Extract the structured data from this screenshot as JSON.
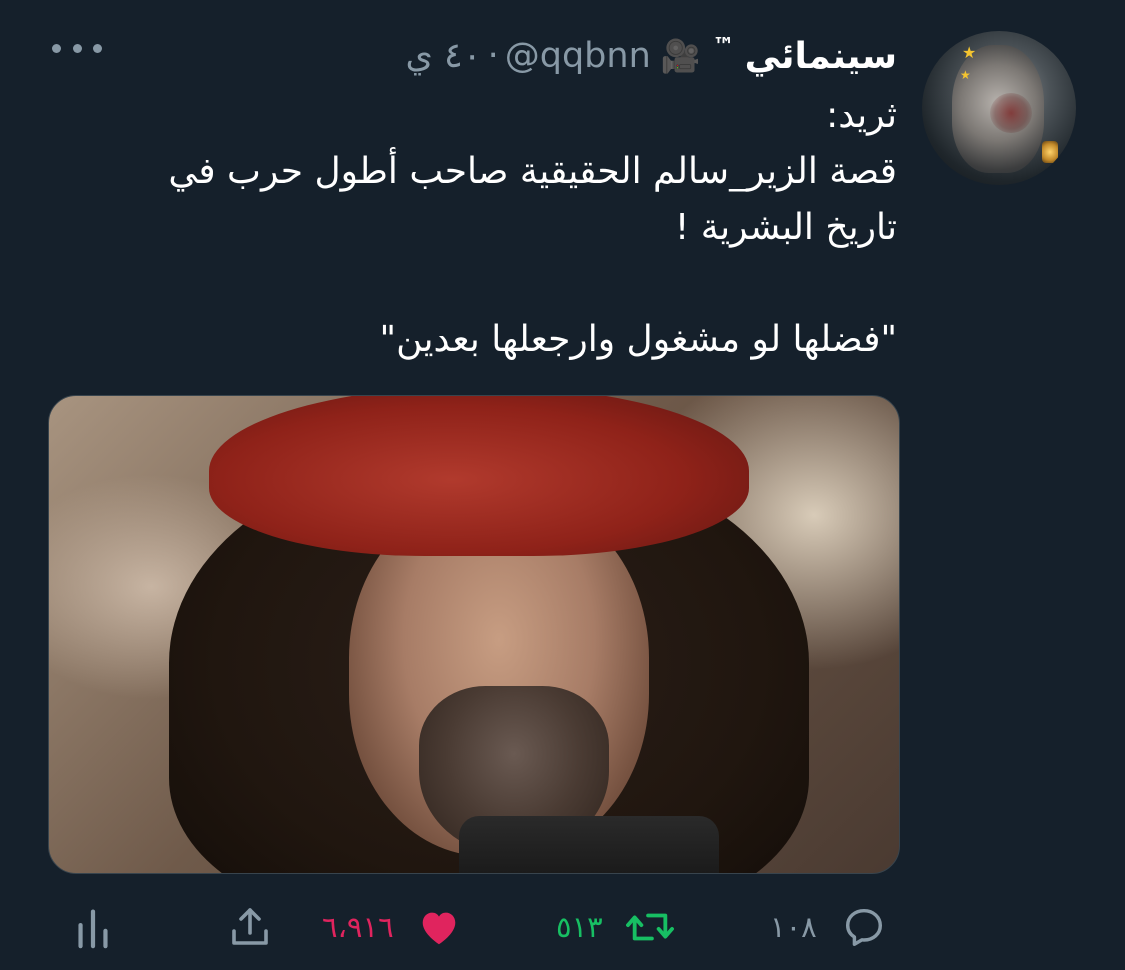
{
  "user": {
    "display_name": "سينمائي",
    "tm": "™",
    "emoji": "🎥",
    "handle": "@qqbnn",
    "separator": "·",
    "time": "٤٠ ي"
  },
  "tweet": {
    "lines": [
      "ثريد:",
      "قصة الزير_سالم الحقيقية صاحب أطول حرب في",
      "تاريخ البشرية !",
      "",
      "\"فضلها لو مشغول وارجعلها بعدين\""
    ]
  },
  "actions": {
    "reply_count": "١٠٨",
    "retweet_count": "٥١٣",
    "like_count": "٦،٩١٦"
  },
  "colors": {
    "background": "#15202b",
    "secondary_text": "#8899a6",
    "retweet": "#17bf63",
    "like": "#e0245e"
  },
  "icons": {
    "more": "more-icon",
    "reply": "reply-icon",
    "retweet": "retweet-icon",
    "like": "heart-icon",
    "share": "share-icon",
    "analytics": "analytics-icon"
  }
}
